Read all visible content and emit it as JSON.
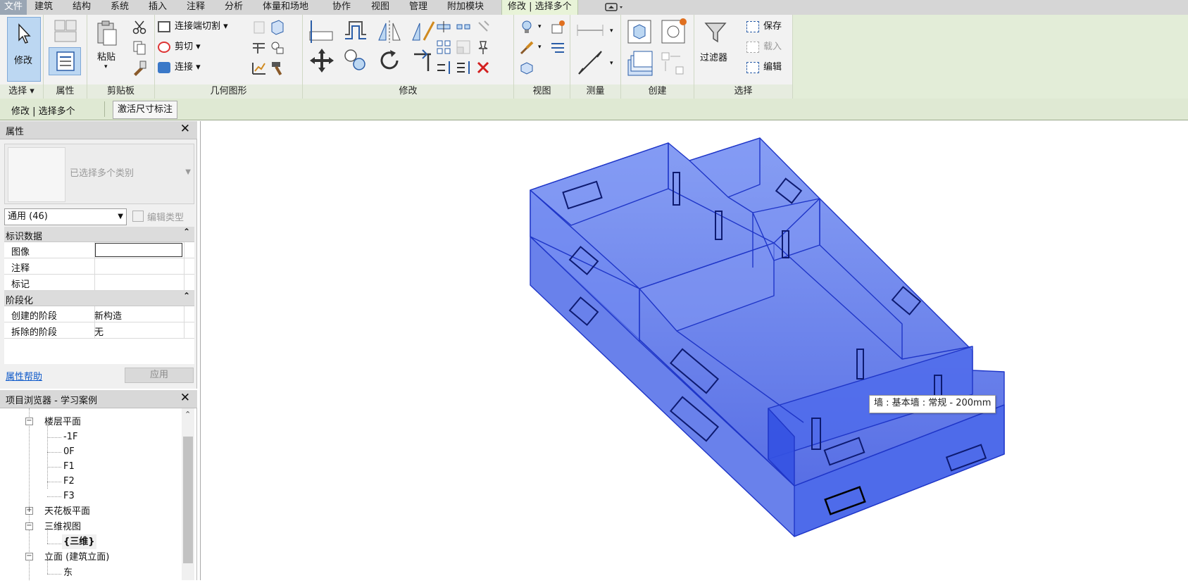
{
  "tabs": [
    {
      "label": "文件"
    },
    {
      "label": "建筑"
    },
    {
      "label": "结构"
    },
    {
      "label": "系统"
    },
    {
      "label": "插入"
    },
    {
      "label": "注释"
    },
    {
      "label": "分析"
    },
    {
      "label": "体量和场地"
    },
    {
      "label": "协作"
    },
    {
      "label": "视图"
    },
    {
      "label": "管理"
    },
    {
      "label": "附加模块"
    },
    {
      "label": "修改 | 选择多个"
    }
  ],
  "ribbon": {
    "modify_label": "修改",
    "paste_label": "粘贴",
    "join_cut_label": "连接端切割",
    "cut_label": "剪切",
    "join_label": "连接",
    "filter_label": "过滤器",
    "save_label": "保存",
    "load_label": "载入",
    "edit_label": "编辑",
    "panels": {
      "select": "选择",
      "properties": "属性",
      "clipboard": "剪贴板",
      "geometry": "几何图形",
      "modify": "修改",
      "view": "视图",
      "measure": "测量",
      "create": "创建",
      "selection": "选择"
    }
  },
  "context_bar": {
    "mode": "修改 | 选择多个",
    "option": "激活尺寸标注"
  },
  "properties": {
    "title": "属性",
    "type_name": "已选择多个类别",
    "filter": "通用 (46)",
    "edit_type": "编辑类型",
    "groups": [
      {
        "name": "标识数据",
        "rows": [
          {
            "key": "图像",
            "value": ""
          },
          {
            "key": "注释",
            "value": ""
          },
          {
            "key": "标记",
            "value": ""
          }
        ]
      },
      {
        "name": "阶段化",
        "rows": [
          {
            "key": "创建的阶段",
            "value": "新构造"
          },
          {
            "key": "拆除的阶段",
            "value": "无"
          }
        ]
      }
    ],
    "help_link": "属性帮助",
    "apply_label": "应用"
  },
  "browser": {
    "title": "项目浏览器 - 学习案例",
    "items": [
      {
        "label": "楼层平面"
      },
      {
        "label": "-1F"
      },
      {
        "label": "0F"
      },
      {
        "label": "F1"
      },
      {
        "label": "F2"
      },
      {
        "label": "F3"
      },
      {
        "label": "天花板平面"
      },
      {
        "label": "三维视图"
      },
      {
        "label": "{三维}"
      },
      {
        "label": "立面 (建筑立面)"
      },
      {
        "label": "东"
      }
    ]
  },
  "canvas": {
    "tooltip": "墙 : 基本墙 : 常规 - 200mm",
    "selection_color": "#2f4fe6"
  }
}
